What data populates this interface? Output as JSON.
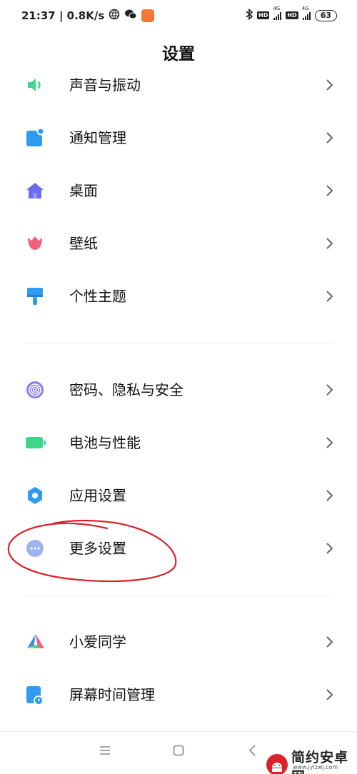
{
  "status_bar": {
    "time_speed": "21:37 | 0.8K/s",
    "network_label": "4G",
    "hd_label": "HD",
    "battery": "63"
  },
  "header": {
    "title": "设置"
  },
  "sections": [
    {
      "items": [
        {
          "label": "声音与振动",
          "icon": "speaker-icon",
          "color": "#3dd68c"
        },
        {
          "label": "通知管理",
          "icon": "notification-icon",
          "color": "#2f9bf0"
        },
        {
          "label": "桌面",
          "icon": "home-icon",
          "color": "#6c6cf2"
        },
        {
          "label": "壁纸",
          "icon": "tulip-icon",
          "color": "#f25f7d"
        },
        {
          "label": "个性主题",
          "icon": "paintbrush-icon",
          "color": "#2f9bf0"
        }
      ]
    },
    {
      "items": [
        {
          "label": "密码、隐私与安全",
          "icon": "fingerprint-icon",
          "color": "#8c7df0"
        },
        {
          "label": "电池与性能",
          "icon": "battery-icon",
          "color": "#3dd68c"
        },
        {
          "label": "应用设置",
          "icon": "gear-icon",
          "color": "#2f9bf0"
        },
        {
          "label": "更多设置",
          "icon": "more-dots-icon",
          "color": "#9eb3ee"
        }
      ]
    },
    {
      "items": [
        {
          "label": "小爱同学",
          "icon": "xiaoai-icon",
          "color": "#3b8cf5"
        },
        {
          "label": "屏幕时间管理",
          "icon": "screen-time-icon",
          "color": "#2f9bf0"
        }
      ]
    }
  ],
  "annotation": {
    "color": "#d8232a",
    "target": "更多设置"
  },
  "watermark": {
    "name": "简约安卓网",
    "url": "www.jylzwj.com"
  }
}
